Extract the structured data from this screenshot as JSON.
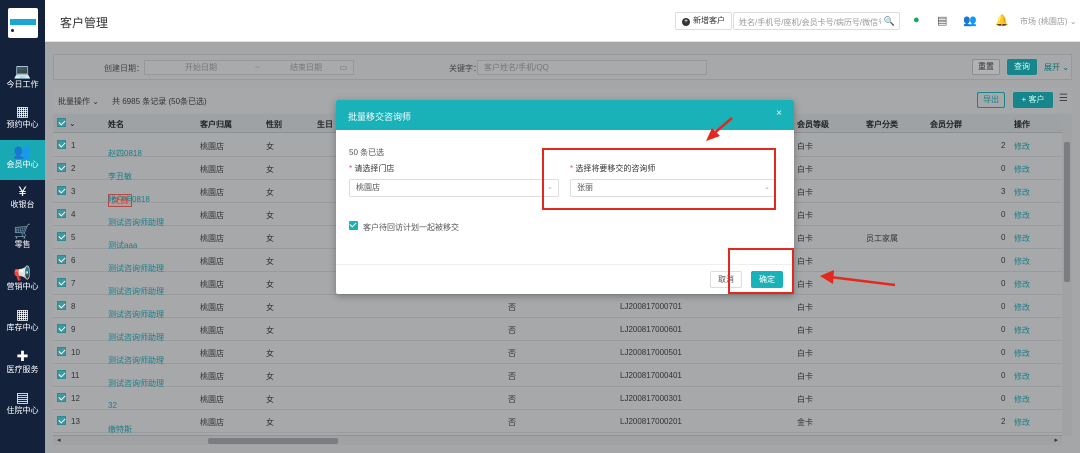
{
  "sidebar": {
    "items": [
      {
        "icon": "laptop-icon",
        "glyph": "💻",
        "label": "今日工作"
      },
      {
        "icon": "calendar-icon",
        "glyph": "▦",
        "label": "预约中心"
      },
      {
        "icon": "members-icon",
        "glyph": "👥",
        "label": "会员中心",
        "active": true
      },
      {
        "icon": "yen-icon",
        "glyph": "¥",
        "label": "收银台"
      },
      {
        "icon": "cart-icon",
        "glyph": "🛒",
        "label": "零售"
      },
      {
        "icon": "megaphone-icon",
        "glyph": "📢",
        "label": "营销中心"
      },
      {
        "icon": "grid-icon",
        "glyph": "▦",
        "label": "库存中心"
      },
      {
        "icon": "medkit-icon",
        "glyph": "✚",
        "label": "医疗服务"
      },
      {
        "icon": "building-icon",
        "glyph": "▤",
        "label": "住院中心"
      }
    ]
  },
  "header": {
    "title": "客户管理",
    "new_customer": "新增客户",
    "search_placeholder": "姓名/手机号/座机/会员卡号/病历号/微信号",
    "store": "市场 (桃園店)"
  },
  "filter": {
    "created_label": "创建日期：",
    "start_placeholder": "开始日期",
    "separator": "~",
    "end_placeholder": "结束日期",
    "keyword_label": "关键字：",
    "keyword_placeholder": "客户姓名/手机/QQ",
    "reset": "重置",
    "query": "查询",
    "expand": "展开"
  },
  "toolbar": {
    "batch": "批量操作",
    "summary": "共 6985 条记录 (50条已选)",
    "export": "导出",
    "add_customer": "+ 客户"
  },
  "table": {
    "headers": {
      "name": "姓名",
      "store": "客户归属",
      "gender": "性别",
      "birthday": "生日",
      "level": "会员等级",
      "category": "客户分类",
      "group": "会员分群",
      "op": "操作"
    },
    "rows": [
      {
        "idx": "1",
        "name": "赵四0818",
        "store": "桃園店",
        "gender": "女",
        "flag": "",
        "card": "",
        "level": "白卡",
        "category": "",
        "count": "2",
        "op": "修改"
      },
      {
        "idx": "2",
        "name": "李丑敏",
        "store": "桃園店",
        "gender": "女",
        "flag": "",
        "card": "",
        "level": "白卡",
        "category": "",
        "count": "0",
        "op": "修改"
      },
      {
        "idx": "3",
        "tag": "欠费",
        "name": "帐户卡0818",
        "store": "桃園店",
        "gender": "女",
        "flag": "",
        "card": "",
        "level": "白卡",
        "category": "",
        "count": "3",
        "op": "修改"
      },
      {
        "idx": "4",
        "name": "测试咨询师助理",
        "store": "桃園店",
        "gender": "女",
        "flag": "",
        "card": "",
        "level": "白卡",
        "category": "",
        "count": "0",
        "op": "修改"
      },
      {
        "idx": "5",
        "name": "测试aaa",
        "store": "桃園店",
        "gender": "女",
        "flag": "",
        "card": "",
        "level": "白卡",
        "category": "员工家属",
        "count": "0",
        "op": "修改"
      },
      {
        "idx": "6",
        "name": "测试咨询师助理",
        "store": "桃園店",
        "gender": "女",
        "flag": "",
        "card": "",
        "level": "白卡",
        "category": "",
        "count": "0",
        "op": "修改"
      },
      {
        "idx": "7",
        "name": "测试咨询师助理",
        "store": "桃園店",
        "gender": "女",
        "flag": "",
        "card": "",
        "level": "白卡",
        "category": "",
        "count": "0",
        "op": "修改"
      },
      {
        "idx": "8",
        "name": "测试咨询师助理",
        "store": "桃園店",
        "gender": "女",
        "flag": "否",
        "card": "LJ200817000701",
        "level": "白卡",
        "category": "",
        "count": "0",
        "op": "修改"
      },
      {
        "idx": "9",
        "name": "测试咨询师助理",
        "store": "桃園店",
        "gender": "女",
        "flag": "否",
        "card": "LJ200817000601",
        "level": "白卡",
        "category": "",
        "count": "0",
        "op": "修改"
      },
      {
        "idx": "10",
        "name": "测试咨询师助理",
        "store": "桃園店",
        "gender": "女",
        "flag": "否",
        "card": "LJ200817000501",
        "level": "白卡",
        "category": "",
        "count": "0",
        "op": "修改"
      },
      {
        "idx": "11",
        "name": "测试咨询师助理",
        "store": "桃園店",
        "gender": "女",
        "flag": "否",
        "card": "LJ200817000401",
        "level": "白卡",
        "category": "",
        "count": "0",
        "op": "修改"
      },
      {
        "idx": "12",
        "name": "32",
        "store": "桃園店",
        "gender": "女",
        "flag": "否",
        "card": "LJ200817000301",
        "level": "白卡",
        "category": "",
        "count": "0",
        "op": "修改"
      },
      {
        "idx": "13",
        "name": "缴特斯",
        "store": "桃園店",
        "gender": "女",
        "flag": "否",
        "card": "LJ200817000201",
        "level": "金卡",
        "category": "",
        "count": "2",
        "op": "修改"
      }
    ]
  },
  "modal": {
    "title": "批量移交咨询师",
    "selected": "50 条已选",
    "store_label": "请选择门店",
    "store_value": "桃園店",
    "consultant_label": "选择将要移交的咨询师",
    "consultant_value": "张丽",
    "checkbox_label": "客户待回访计划一起被移交",
    "cancel": "取消",
    "confirm": "确定",
    "close": "×"
  },
  "colors": {
    "teal": "#19b2b9",
    "sidebar": "#14213b",
    "annotation": "#e5281e"
  }
}
